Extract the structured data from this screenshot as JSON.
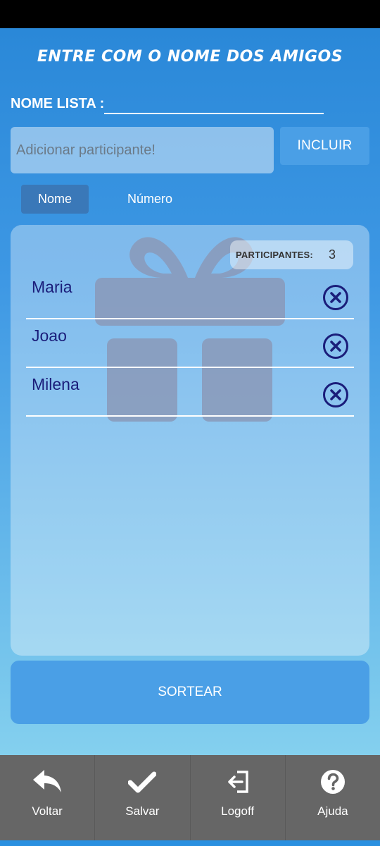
{
  "header": {
    "title": "ENTRE COM O NOME DOS AMIGOS"
  },
  "list_name": {
    "label": "NOME LISTA :",
    "value": ""
  },
  "add_participant": {
    "placeholder": "Adicionar participante!",
    "button_label": "INCLUIR"
  },
  "tabs": [
    {
      "label": "Nome",
      "active": true
    },
    {
      "label": "Número",
      "active": false
    }
  ],
  "participants_panel": {
    "count_label": "PARTICIPANTES:",
    "count_value": "3",
    "items": [
      {
        "name": "Maria",
        "remove_icon": "close-circle-icon"
      },
      {
        "name": "Joao",
        "remove_icon": "close-circle-icon"
      },
      {
        "name": "Milena",
        "remove_icon": "close-circle-icon"
      }
    ],
    "background_icon": "gift-icon"
  },
  "draw_button": {
    "label": "SORTEAR"
  },
  "bottom_nav": [
    {
      "label": "Voltar",
      "icon": "back-arrow-icon"
    },
    {
      "label": "Salvar",
      "icon": "checkmark-icon"
    },
    {
      "label": "Logoff",
      "icon": "logout-icon"
    },
    {
      "label": "Ajuda",
      "icon": "help-icon"
    }
  ],
  "colors": {
    "background_top": "#2a88d8",
    "background_bottom": "#84d0ee",
    "button": "#4a9fe6",
    "name_text": "#1a1d7a",
    "nav_background": "#666666"
  }
}
